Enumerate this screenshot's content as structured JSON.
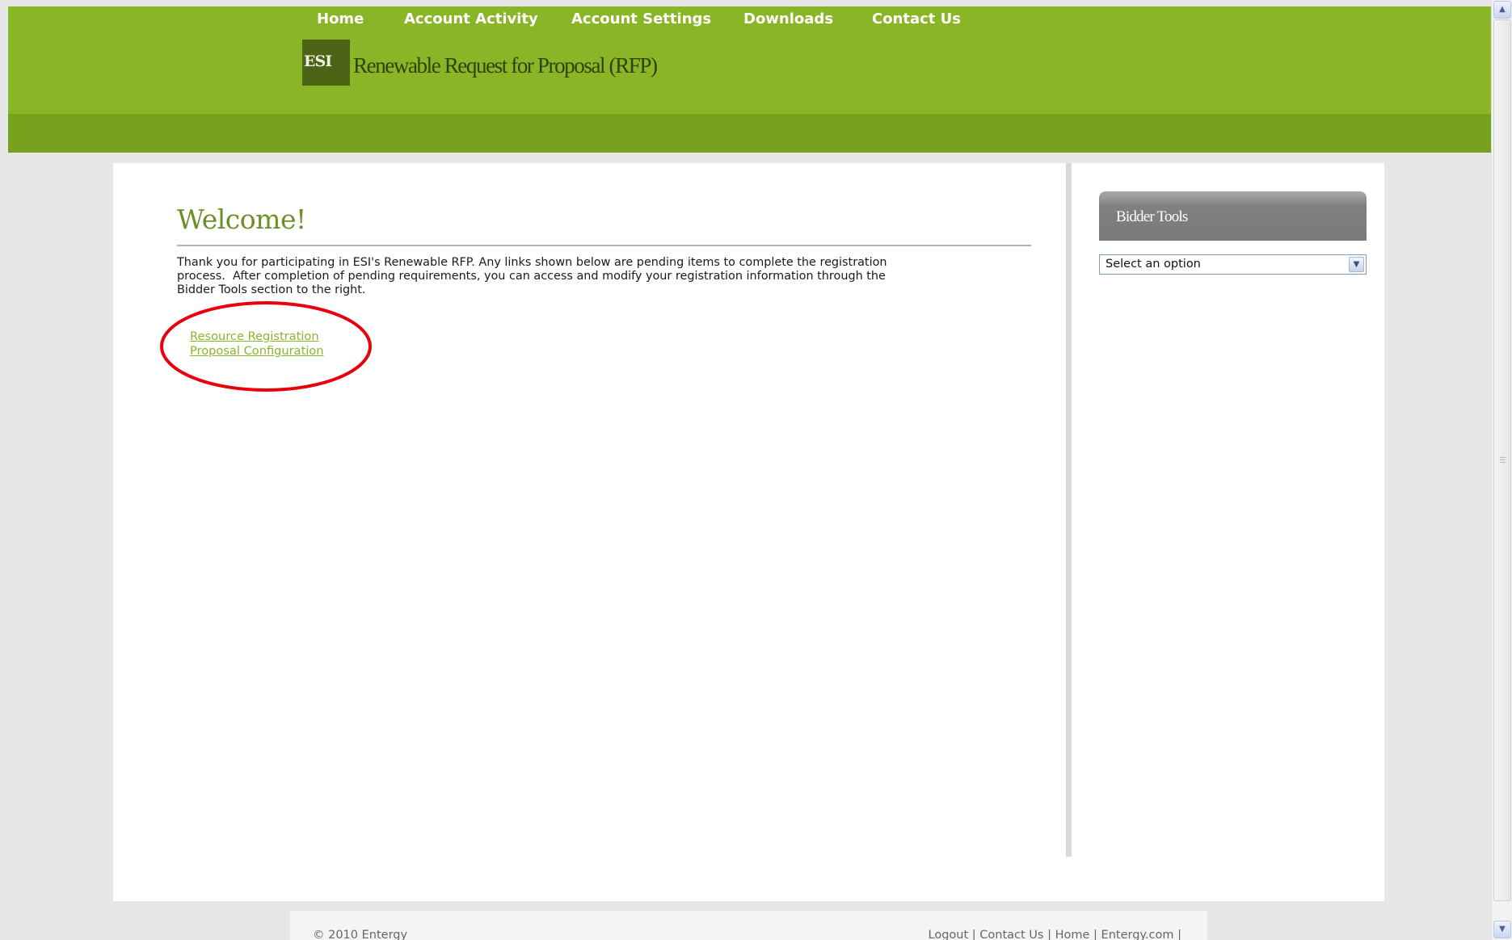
{
  "header": {
    "logo_text": "ESI",
    "site_title": "Renewable Request for Proposal (RFP)"
  },
  "nav": {
    "items": [
      {
        "label": "Home"
      },
      {
        "label": "Account Activity"
      },
      {
        "label": "Account Settings"
      },
      {
        "label": "Downloads"
      },
      {
        "label": "Contact Us"
      }
    ]
  },
  "main": {
    "heading": "Welcome!",
    "intro_lines": [
      "Thank you for participating in ESI's Renewable RFP. Any links shown below are pending items to complete the registration",
      "process.  After completion of pending requirements, you can access and modify your registration information through the",
      "Bidder Tools section to the right."
    ],
    "pending_links": [
      {
        "label": "Resource Registration"
      },
      {
        "label": "Proposal Configuration"
      }
    ],
    "annotation_color": "#e8000b"
  },
  "sidebar": {
    "title": "Bidder Tools",
    "select_value": "Select an option"
  },
  "footer": {
    "copyright": "© 2010 Entergy",
    "links": [
      "Logout",
      "Contact Us",
      "Home",
      "Entergy.com"
    ],
    "separator": "|"
  },
  "colors": {
    "header_green": "#8ab527",
    "nav_green": "#76a11d",
    "logo_dark": "#4b6415",
    "link_green": "#8bb52c"
  }
}
